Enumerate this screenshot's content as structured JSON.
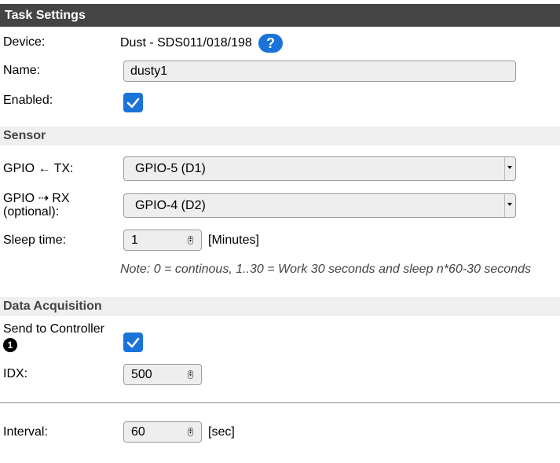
{
  "task_settings": {
    "title": "Task Settings",
    "device_label": "Device:",
    "device_value": "Dust - SDS011/018/198",
    "help_icon": "?",
    "name_label": "Name:",
    "name_value": "dusty1",
    "enabled_label": "Enabled:",
    "enabled_checked": true
  },
  "sensor": {
    "title": "Sensor",
    "gpio_tx_label": "GPIO ← TX:",
    "gpio_tx_value": "GPIO-5 (D1)",
    "gpio_rx_label_line1": "GPIO ⇢ RX",
    "gpio_rx_label_line2": "(optional):",
    "gpio_rx_value": "GPIO-4 (D2)",
    "sleep_label": "Sleep time:",
    "sleep_value": "1",
    "sleep_unit": "[Minutes]",
    "note": "Note: 0 = continous, 1..30 = Work 30 seconds and sleep n*60-30 seconds"
  },
  "data_acquisition": {
    "title": "Data Acquisition",
    "send_label": "Send to Controller",
    "send_badge": "1",
    "send_checked": true,
    "idx_label": "IDX:",
    "idx_value": "500",
    "interval_label": "Interval:",
    "interval_value": "60",
    "interval_unit": "[sec]"
  },
  "colors": {
    "header_dark": "#444444",
    "header_light": "#efefef",
    "accent": "#1a73d9"
  }
}
